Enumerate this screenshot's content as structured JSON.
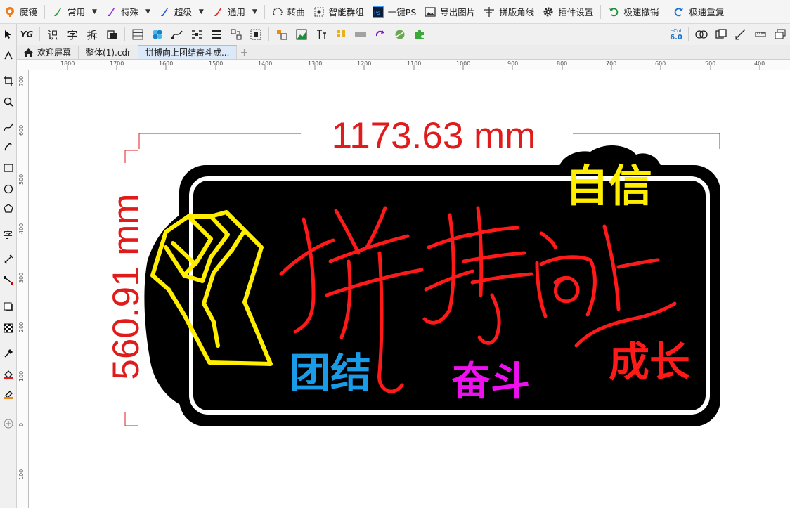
{
  "menubar": {
    "app_name": "魔镜",
    "items": [
      {
        "label": "常用",
        "dropdown": true
      },
      {
        "label": "特殊",
        "dropdown": true
      },
      {
        "label": "超级",
        "dropdown": true
      },
      {
        "label": "通用",
        "dropdown": true
      },
      {
        "label": "转曲"
      },
      {
        "label": "智能群组"
      },
      {
        "label": "一键PS"
      },
      {
        "label": "导出图片"
      },
      {
        "label": "拼版角线"
      },
      {
        "label": "插件设置"
      },
      {
        "label": "极速撤销"
      },
      {
        "label": "极速重复"
      }
    ]
  },
  "toolbar2": {
    "text_buttons": [
      "识",
      "字",
      "拆"
    ],
    "ecut_version": "6.0",
    "ecut_label": "eCut"
  },
  "tabs": [
    {
      "label": "欢迎屏幕"
    },
    {
      "label": "整体(1).cdr"
    },
    {
      "label": "拼搏向上团结奋斗成..."
    }
  ],
  "ruler": {
    "top_labels": [
      "1800",
      "1700",
      "1600",
      "1500",
      "1400",
      "1300",
      "1200",
      "1100",
      "1000",
      "900",
      "800",
      "700",
      "600",
      "500",
      "400"
    ],
    "left_labels": [
      "700",
      "600",
      "500",
      "400",
      "300",
      "200",
      "100",
      "0",
      "100"
    ]
  },
  "design": {
    "width_dimension": "1173.63 mm",
    "height_dimension": "560.91 mm",
    "headline": "拼搏向上",
    "word_confidence": "自信",
    "word_unity": "团结",
    "word_struggle": "奋斗",
    "word_growth": "成长",
    "colors": {
      "dimension_red": "#e01b1b",
      "neon_red": "#ff1a1a",
      "neon_yellow": "#ffee00",
      "neon_blue": "#1a9be8",
      "neon_magenta": "#ee10ee",
      "board_black": "#000000",
      "outline_white": "#ffffff"
    }
  }
}
